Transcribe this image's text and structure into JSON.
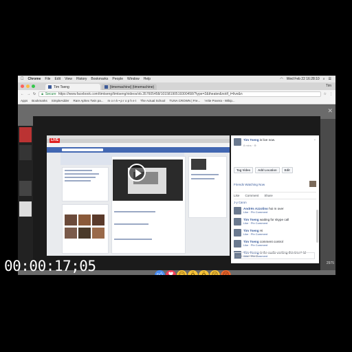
{
  "mac_menu": {
    "app": "Chrome",
    "items": [
      "File",
      "Edit",
      "View",
      "History",
      "Bookmarks",
      "People",
      "Window",
      "Help"
    ],
    "clock": "Wed Feb 22  16:28:10"
  },
  "browser": {
    "tabs": [
      "Tim Tseng",
      "[timemachine] (timemachine)"
    ],
    "user": "Tim",
    "secure_label": "Secure",
    "url": "https://www.facebook.com/timtseng/timtseng/videos/vb.357605458/10158190519300458/?type=2&theater&notif_t=live&n",
    "bookmarks": [
      "Apps",
      "Bookmarks",
      "SimpleAdder",
      "Rare Aphex Twin pa...",
      "m o n k • p r o p h e t",
      "The Actual School",
      "TUNA CROWN | Fre...",
      "'Artie Povera - Wikip..."
    ]
  },
  "page": {
    "bottom_num": "2975"
  },
  "video": {
    "live_label": "LIVE"
  },
  "post": {
    "author": "Tim Tseng",
    "status": "is live now.",
    "time": "8 mins",
    "actions": [
      "Tag Video",
      "Add Location",
      "Edit"
    ],
    "friends_watching": "Friends Watching Now",
    "reactions": [
      "Like",
      "Comment",
      "Share"
    ],
    "seen_by": "J-y Caron",
    "comments": [
      {
        "user": "Andrés Azzolino",
        "text": "hoi m over",
        "actions": "Like · Pin Comment"
      },
      {
        "user": "Tim Tseng",
        "text": "waiting for skype call",
        "actions": "Like · Pin Comment"
      },
      {
        "user": "Tim Tseng",
        "text": "Hi",
        "actions": "Like · Pin Comment"
      },
      {
        "user": "Tim Tseng",
        "text": "comment control",
        "actions": "Like · Pin Comment"
      },
      {
        "user": "Tim Tseng",
        "text": "is the audio working this time? lol",
        "actions": "Like · Pin Comment"
      }
    ],
    "write_placeholder": "Write a comment..."
  },
  "reaction_icons": [
    "like-icon",
    "love-icon",
    "haha-icon",
    "wow-icon",
    "wow-icon",
    "sad-icon",
    "angry-icon"
  ],
  "reaction_colors": [
    "#4a8df2",
    "#f2405a",
    "#f7c43a",
    "#f7c43a",
    "#f7c43a",
    "#f7c43a",
    "#f06a2f"
  ],
  "timecode": "00:00:17;05"
}
